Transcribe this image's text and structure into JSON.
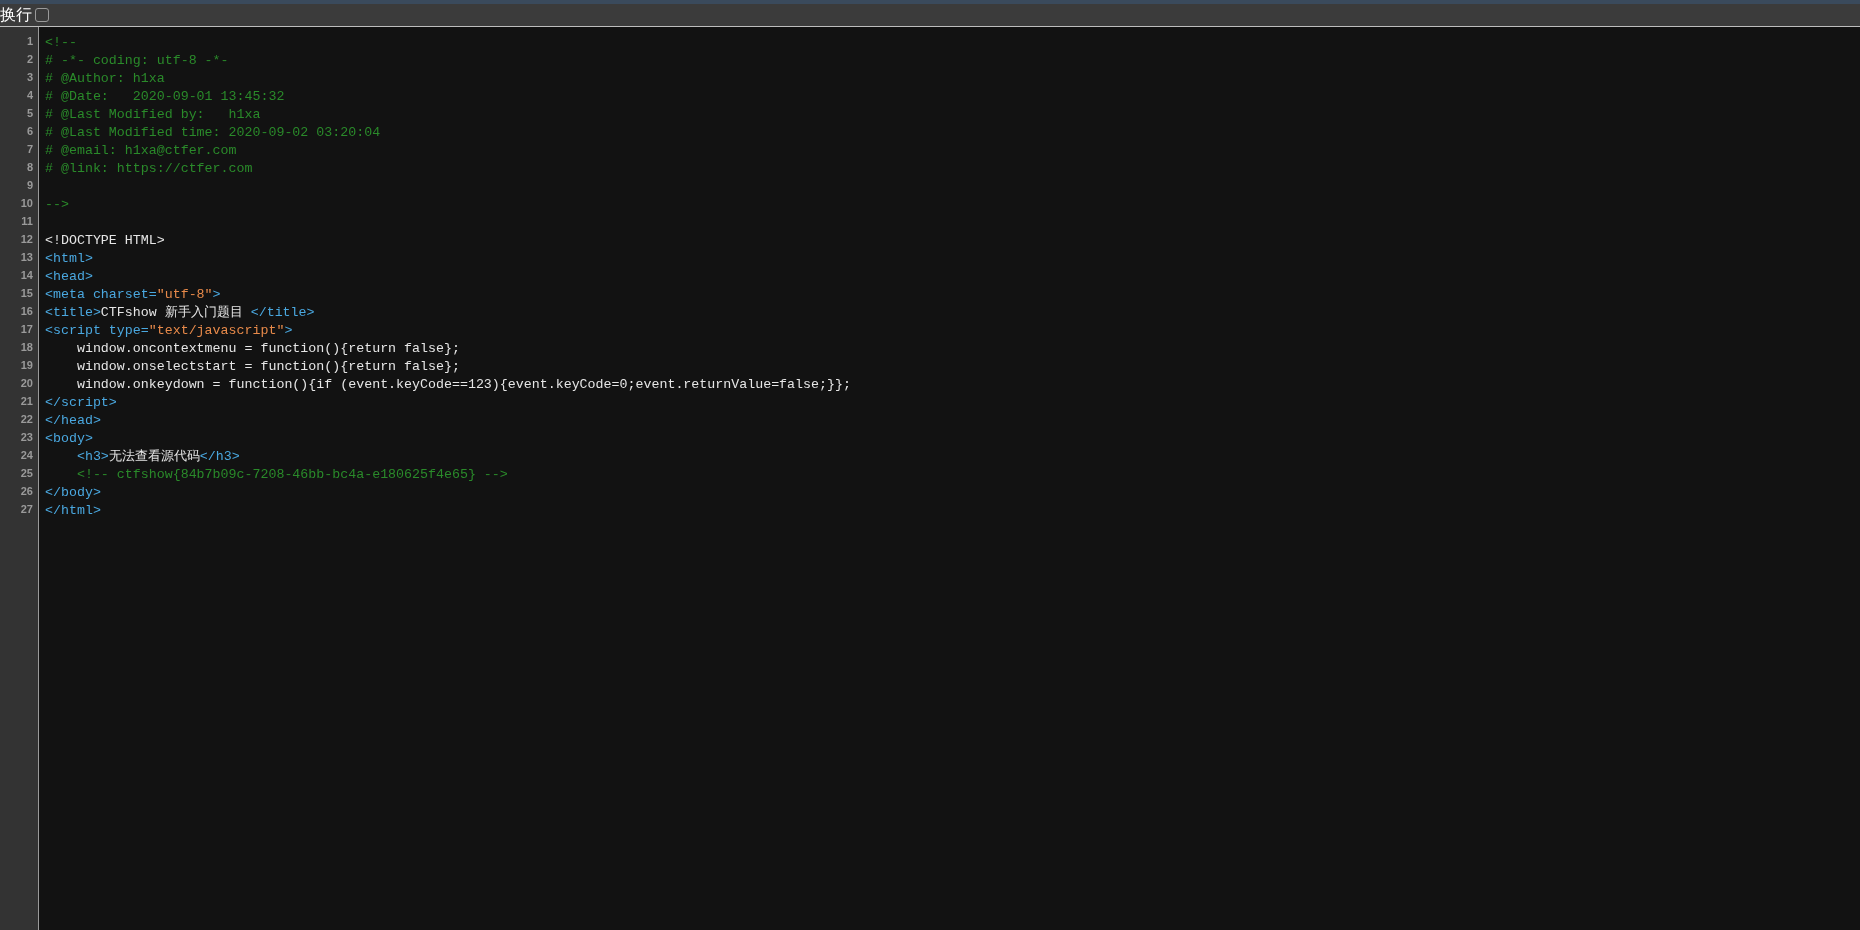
{
  "toolbar": {
    "wrap_label": "换行",
    "wrap_checked": false
  },
  "lines": [
    {
      "number": "1",
      "tokens": [
        {
          "kind": "comment",
          "text": "<!--"
        }
      ]
    },
    {
      "number": "2",
      "tokens": [
        {
          "kind": "comment",
          "text": "# -*- coding: utf-8 -*-"
        }
      ]
    },
    {
      "number": "3",
      "tokens": [
        {
          "kind": "comment",
          "text": "# @Author: h1xa"
        }
      ]
    },
    {
      "number": "4",
      "tokens": [
        {
          "kind": "comment",
          "text": "# @Date:   2020-09-01 13:45:32"
        }
      ]
    },
    {
      "number": "5",
      "tokens": [
        {
          "kind": "comment",
          "text": "# @Last Modified by:   h1xa"
        }
      ]
    },
    {
      "number": "6",
      "tokens": [
        {
          "kind": "comment",
          "text": "# @Last Modified time: 2020-09-02 03:20:04"
        }
      ]
    },
    {
      "number": "7",
      "tokens": [
        {
          "kind": "comment",
          "text": "# @email: h1xa@ctfer.com"
        }
      ]
    },
    {
      "number": "8",
      "tokens": [
        {
          "kind": "comment",
          "text": "# @link: https://ctfer.com"
        }
      ]
    },
    {
      "number": "9"
    },
    {
      "number": "10",
      "tokens": [
        {
          "kind": "comment",
          "text": "-->"
        }
      ]
    },
    {
      "number": "11"
    },
    {
      "number": "12",
      "tokens": [
        {
          "kind": "text",
          "text": "<!DOCTYPE HTML>"
        }
      ]
    },
    {
      "number": "13",
      "tokens": [
        {
          "kind": "tag",
          "text": "<html>"
        }
      ]
    },
    {
      "number": "14",
      "tokens": [
        {
          "kind": "tag",
          "text": "<head>"
        }
      ]
    },
    {
      "number": "15",
      "tokens": [
        {
          "kind": "tag",
          "text": "<meta charset="
        },
        {
          "kind": "string",
          "text": "\"utf-8\""
        },
        {
          "kind": "tag",
          "text": ">"
        }
      ]
    },
    {
      "number": "16",
      "tokens": [
        {
          "kind": "tag",
          "text": "<title>"
        },
        {
          "kind": "text",
          "text": "CTFshow 新手入门题目 "
        },
        {
          "kind": "tag",
          "text": "</title>"
        }
      ]
    },
    {
      "number": "17",
      "tokens": [
        {
          "kind": "tag",
          "text": "<script type="
        },
        {
          "kind": "string",
          "text": "\"text/javascript\""
        },
        {
          "kind": "tag",
          "text": ">"
        }
      ]
    },
    {
      "number": "18",
      "tokens": [
        {
          "kind": "text",
          "text": "    window.oncontextmenu = function(){return false};"
        }
      ]
    },
    {
      "number": "19",
      "tokens": [
        {
          "kind": "text",
          "text": "    window.onselectstart = function(){return false};"
        }
      ]
    },
    {
      "number": "20",
      "tokens": [
        {
          "kind": "text",
          "text": "    window.onkeydown = function(){if (event.keyCode==123){event.keyCode=0;event.returnValue=false;}};"
        }
      ]
    },
    {
      "number": "21",
      "tokens": [
        {
          "kind": "tag",
          "text": "</script>"
        }
      ]
    },
    {
      "number": "22",
      "tokens": [
        {
          "kind": "tag",
          "text": "</head>"
        }
      ]
    },
    {
      "number": "23",
      "tokens": [
        {
          "kind": "tag",
          "text": "<body>"
        }
      ]
    },
    {
      "number": "24",
      "tokens": [
        {
          "kind": "tag",
          "text": "    <h3>"
        },
        {
          "kind": "text",
          "text": "无法查看源代码"
        },
        {
          "kind": "tag",
          "text": "</h3>"
        }
      ]
    },
    {
      "number": "25",
      "tokens": [
        {
          "kind": "comment",
          "text": "    <!-- ctfshow{84b7b09c-7208-46bb-bc4a-e180625f4e65} -->"
        }
      ]
    },
    {
      "number": "26",
      "tokens": [
        {
          "kind": "tag",
          "text": "</body>"
        }
      ]
    },
    {
      "number": "27",
      "tokens": [
        {
          "kind": "tag",
          "text": "</html>"
        }
      ]
    }
  ]
}
